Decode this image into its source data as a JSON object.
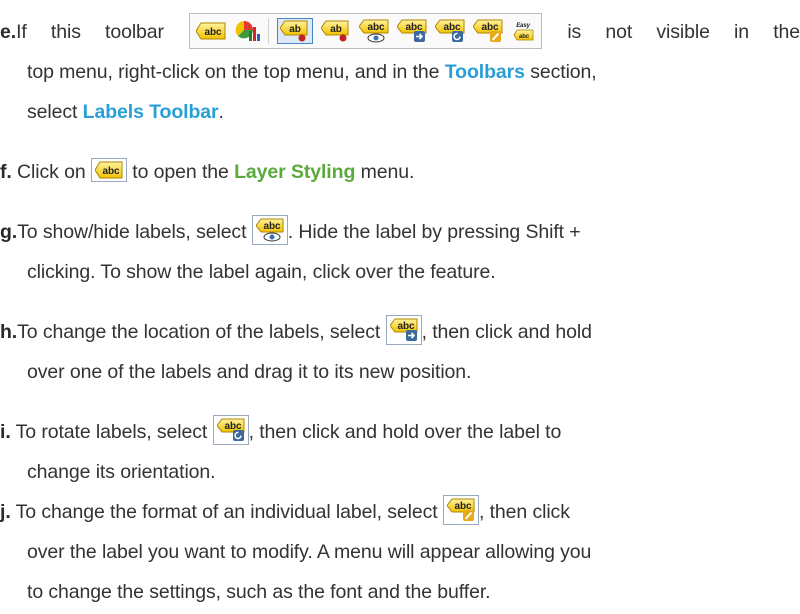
{
  "colors": {
    "accent_blue": "#2a9fd6",
    "accent_green": "#5aaa3c",
    "text": "#333333"
  },
  "steps": [
    {
      "letter": "e.",
      "parts": [
        "If this toolbar",
        "is not visible in the",
        "top menu, right-click on the top menu, and in the",
        "Toolbars",
        "section,",
        "select",
        "Labels Toolbar",
        "."
      ]
    },
    {
      "letter": "f.",
      "parts": [
        "Click on",
        "to open the",
        "Layer Styling",
        "menu."
      ]
    },
    {
      "letter": "g.",
      "parts": [
        "To show/hide labels, select",
        ". Hide the label by pressing Shift +",
        "clicking. To show the label again, click over the feature."
      ]
    },
    {
      "letter": "h.",
      "parts": [
        "To change the location of the labels, select",
        ", then click and hold",
        "over one of the labels and drag it to its new position."
      ]
    },
    {
      "letter": "i.",
      "parts": [
        "To rotate labels, select",
        ", then click and hold over the label to",
        "change its orientation."
      ]
    },
    {
      "letter": "j.",
      "parts": [
        "To change the format of an individual label, select",
        ", then click",
        "over the label you want to modify. A menu will appear allowing you",
        "to change the settings, such as the font and the buffer."
      ]
    }
  ],
  "icon_text": {
    "abc": "abc",
    "ab": "ab",
    "easy": "Easy"
  },
  "icons": [
    "label-tool-icon",
    "diagram-tool-icon",
    "pin-label-icon",
    "highlight-pin-label-icon",
    "show-hide-label-icon",
    "move-label-icon",
    "rotate-label-icon",
    "change-label-icon",
    "easy-label-icon"
  ]
}
